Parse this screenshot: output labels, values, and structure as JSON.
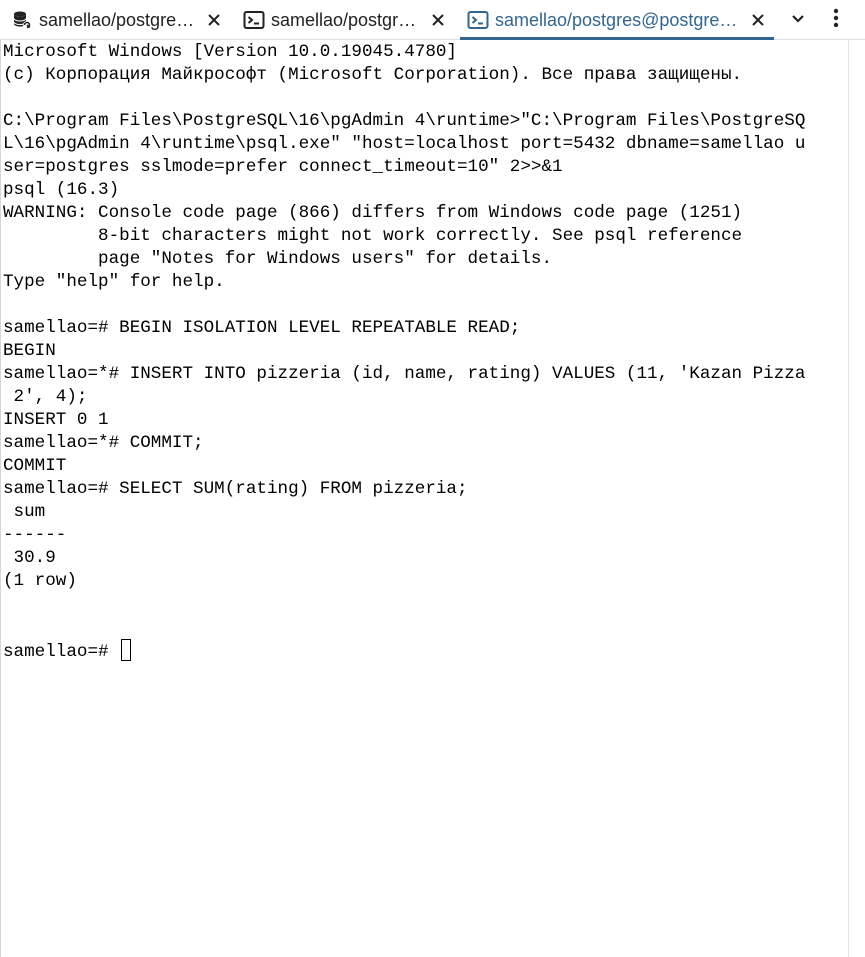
{
  "tabs": [
    {
      "label": "samellao/postgres@postgresql",
      "icon": "database-icon",
      "active": false
    },
    {
      "label": "samellao/postgres@postgresql",
      "icon": "terminal-icon",
      "active": false
    },
    {
      "label": "samellao/postgres@postgresql",
      "icon": "terminal-icon",
      "active": true
    }
  ],
  "colors": {
    "accent": "#326690",
    "text": "#000000",
    "background": "#ffffff"
  },
  "terminal": {
    "lines": [
      "Microsoft Windows [Version 10.0.19045.4780]",
      "(c) Корпорация Майкрософт (Microsoft Corporation). Все права защищены.",
      "",
      "C:\\Program Files\\PostgreSQL\\16\\pgAdmin 4\\runtime>\"C:\\Program Files\\PostgreSQ",
      "L\\16\\pgAdmin 4\\runtime\\psql.exe\" \"host=localhost port=5432 dbname=samellao u",
      "ser=postgres sslmode=prefer connect_timeout=10\" 2>>&1",
      "psql (16.3)",
      "WARNING: Console code page (866) differs from Windows code page (1251)",
      "         8-bit characters might not work correctly. See psql reference",
      "         page \"Notes for Windows users\" for details.",
      "Type \"help\" for help.",
      "",
      "samellao=# BEGIN ISOLATION LEVEL REPEATABLE READ;",
      "BEGIN",
      "samellao=*# INSERT INTO pizzeria (id, name, rating) VALUES (11, 'Kazan Pizza",
      " 2', 4);",
      "INSERT 0 1",
      "samellao=*# COMMIT;",
      "COMMIT",
      "samellao=# SELECT SUM(rating) FROM pizzeria;",
      " sum",
      "------",
      " 30.9",
      "(1 row)",
      "",
      ""
    ],
    "prompt": "samellao=# "
  }
}
